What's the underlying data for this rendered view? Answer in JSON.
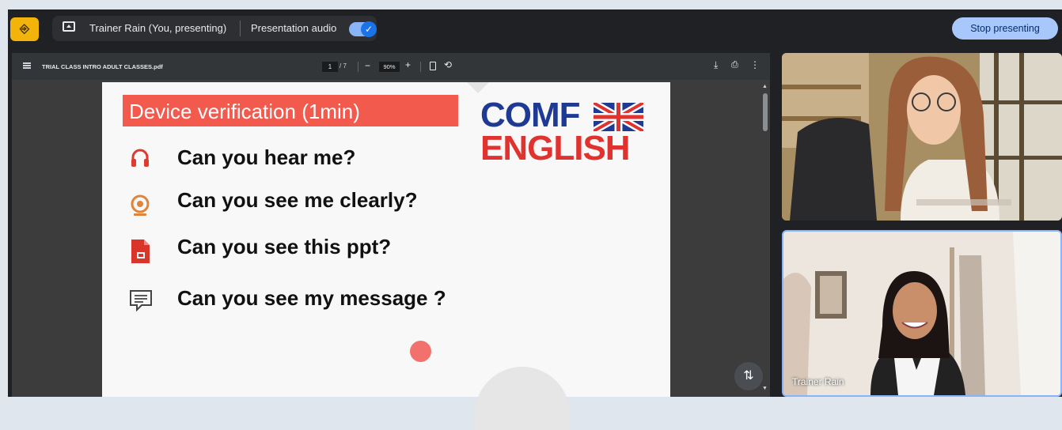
{
  "top_bar": {
    "app_icon": "exit-door-icon",
    "presenter_label": "Trainer Rain (You, presenting)",
    "audio_label": "Presentation audio",
    "audio_enabled": true,
    "stop_button": "Stop presenting"
  },
  "pdf_viewer": {
    "filename": "TRIAL CLASS INTRO ADULT CLASSES.pdf",
    "page_current": "1",
    "page_total": "/ 7",
    "zoom": "90%",
    "zoom_out_symbol": "−",
    "zoom_in_symbol": "+"
  },
  "slide": {
    "title": "Device verification (1min)",
    "logo_line1": "COMF",
    "logo_line2": "ENGLISH",
    "questions": [
      {
        "icon": "headphones-icon",
        "text": "Can you hear me?"
      },
      {
        "icon": "webcam-icon",
        "text": "Can you see me clearly?"
      },
      {
        "icon": "slides-file-icon",
        "text": "Can you see this ppt?"
      },
      {
        "icon": "chat-message-icon",
        "text": "Can you see my message ?"
      }
    ]
  },
  "participants": [
    {
      "name": ""
    },
    {
      "name": "Trainer Rain"
    }
  ],
  "colors": {
    "accent_blue": "#a8c7fa",
    "title_red": "#f25a4e",
    "logo_blue": "#1f3a93",
    "logo_red": "#e0322f",
    "app_yellow": "#f2b40b"
  }
}
